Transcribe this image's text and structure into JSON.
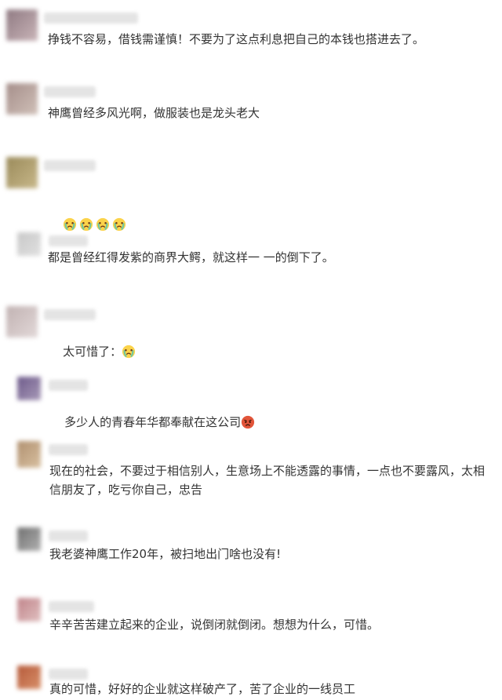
{
  "comments": [
    {
      "text": "挣钱不容易，借钱需谨慎！不要为了这点利息把自己的本钱也搭进去了。"
    },
    {
      "text": "神鹰曾经多风光啊，做服装也是龙头老大"
    },
    {
      "text": ""
    },
    {
      "text": "都是曾经红得发紫的商界大鳄，就这样一 一的倒下了。"
    },
    {
      "text": "太可惜了："
    },
    {
      "text": "多少人的青春年华都奉献在这公司"
    },
    {
      "text": "现在的社会，不要过于相信别人，生意场上不能透露的事情，一点也不要露风，太相信朋友了，吃亏你自己，忠告"
    },
    {
      "text": "我老婆神鹰工作20年，被扫地出门啥也没有!"
    },
    {
      "text": "辛辛苦苦建立起来的企业，说倒闭就倒闭。想想为什么，可惜。"
    },
    {
      "text": "真的可惜，好好的企业就这样破产了，苦了企业的一线员工"
    }
  ],
  "emoji": {
    "crying_color": "#6fc7a0",
    "angry_color": "#e2553a"
  },
  "avatar_colors": [
    "#8f7a82",
    "#a58e8a",
    "#9a8a5a",
    "#c8c8c8",
    "#c1b2b2",
    "#6d5a8a",
    "#b09070",
    "#707070",
    "#c0848a",
    "#b65a3a"
  ]
}
